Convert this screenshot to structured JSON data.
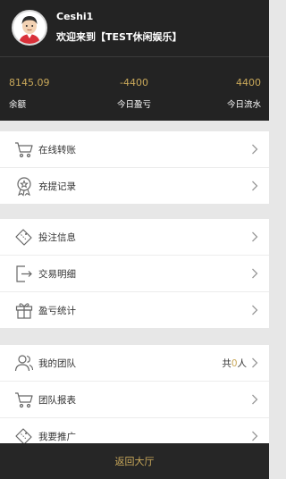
{
  "user": {
    "username": "Ceshi1",
    "welcome": "欢迎来到【TEST休闲娱乐】"
  },
  "stats": [
    {
      "value": "8145.09",
      "label": "余额"
    },
    {
      "value": "-4400",
      "label": "今日盈亏"
    },
    {
      "value": "4400",
      "label": "今日流水"
    }
  ],
  "menu": {
    "section1": [
      {
        "label": "在线转账",
        "icon": "cart-icon"
      },
      {
        "label": "充提记录",
        "icon": "medal-icon"
      }
    ],
    "section2": [
      {
        "label": "投注信息",
        "icon": "ticket-icon"
      },
      {
        "label": "交易明细",
        "icon": "exit-icon"
      },
      {
        "label": "盈亏统计",
        "icon": "gift-icon"
      }
    ],
    "section3": [
      {
        "label": "我的团队",
        "icon": "team-icon",
        "extra_prefix": "共",
        "extra_count": "0",
        "extra_suffix": "人"
      },
      {
        "label": "团队报表",
        "icon": "cart-icon"
      },
      {
        "label": "我要推广",
        "icon": "ticket-icon"
      }
    ]
  },
  "footer": {
    "label": "返回大厅"
  },
  "colors": {
    "gold": "#c9a85a",
    "header_bg": "#232323",
    "page_bg": "#e7e7e7"
  }
}
